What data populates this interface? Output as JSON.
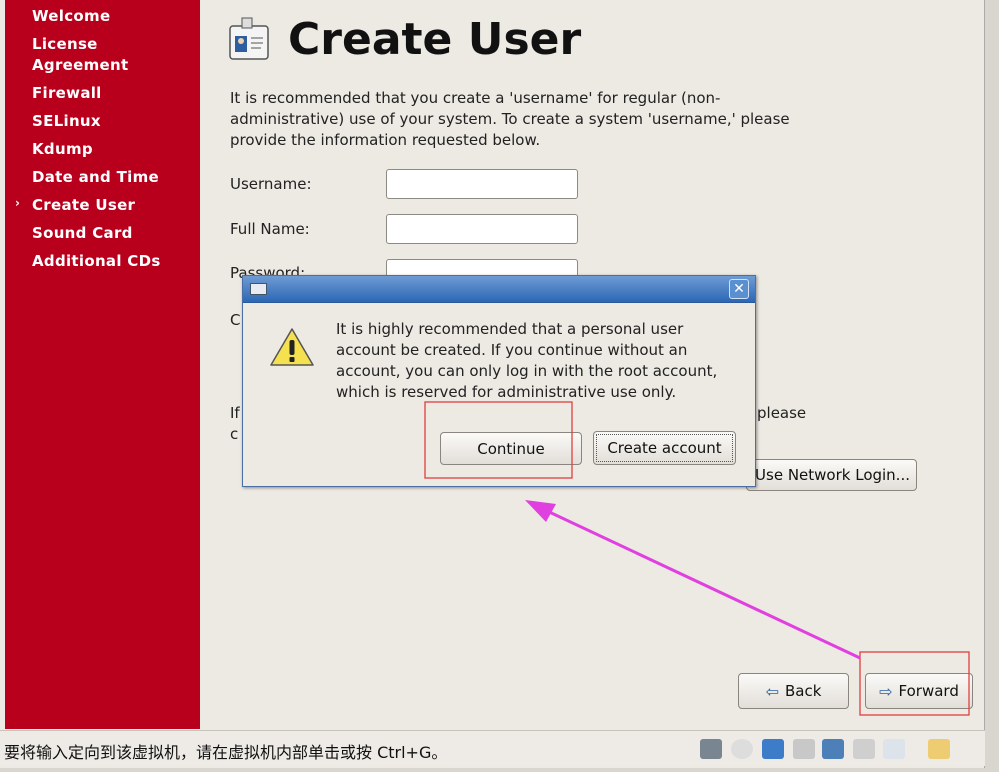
{
  "sidebar": {
    "items": [
      {
        "label": "Welcome"
      },
      {
        "label": "License"
      },
      {
        "label": "Agreement"
      },
      {
        "label": "Firewall"
      },
      {
        "label": "SELinux"
      },
      {
        "label": "Kdump"
      },
      {
        "label": "Date and Time"
      },
      {
        "label": "Create User",
        "current": true
      },
      {
        "label": "Sound Card"
      },
      {
        "label": "Additional CDs"
      }
    ],
    "current_marker": "›"
  },
  "main": {
    "title": "Create User",
    "intro": "It is recommended that you create a 'username' for regular (non-administrative) use of your system. To create a system 'username,' please provide the information requested below.",
    "username_label": "Username:",
    "fullname_label": "Full Name:",
    "password_label": "Password:",
    "confirm_fragment": "C",
    "para_fragment_1": "If",
    "para_fragment_2": "c",
    "para_fragment_3": "please",
    "network_login_fragment": "Use Network Login...",
    "back_label": "Back",
    "forward_label": "Forward"
  },
  "dialog": {
    "message": "It is highly recommended that a personal user account be created.  If you continue without an account, you can only log in with the root account, which is reserved for administrative use only.",
    "continue_label": "Continue",
    "create_account_label": "Create account"
  },
  "statusbar": {
    "hint": "要将输入定向到该虚拟机，请在虚拟机内部单击或按 Ctrl+G。"
  },
  "colors": {
    "sidebar": "#b8001c",
    "annotation_box": "#e04040",
    "annotation_arrow": "#e040e0"
  }
}
